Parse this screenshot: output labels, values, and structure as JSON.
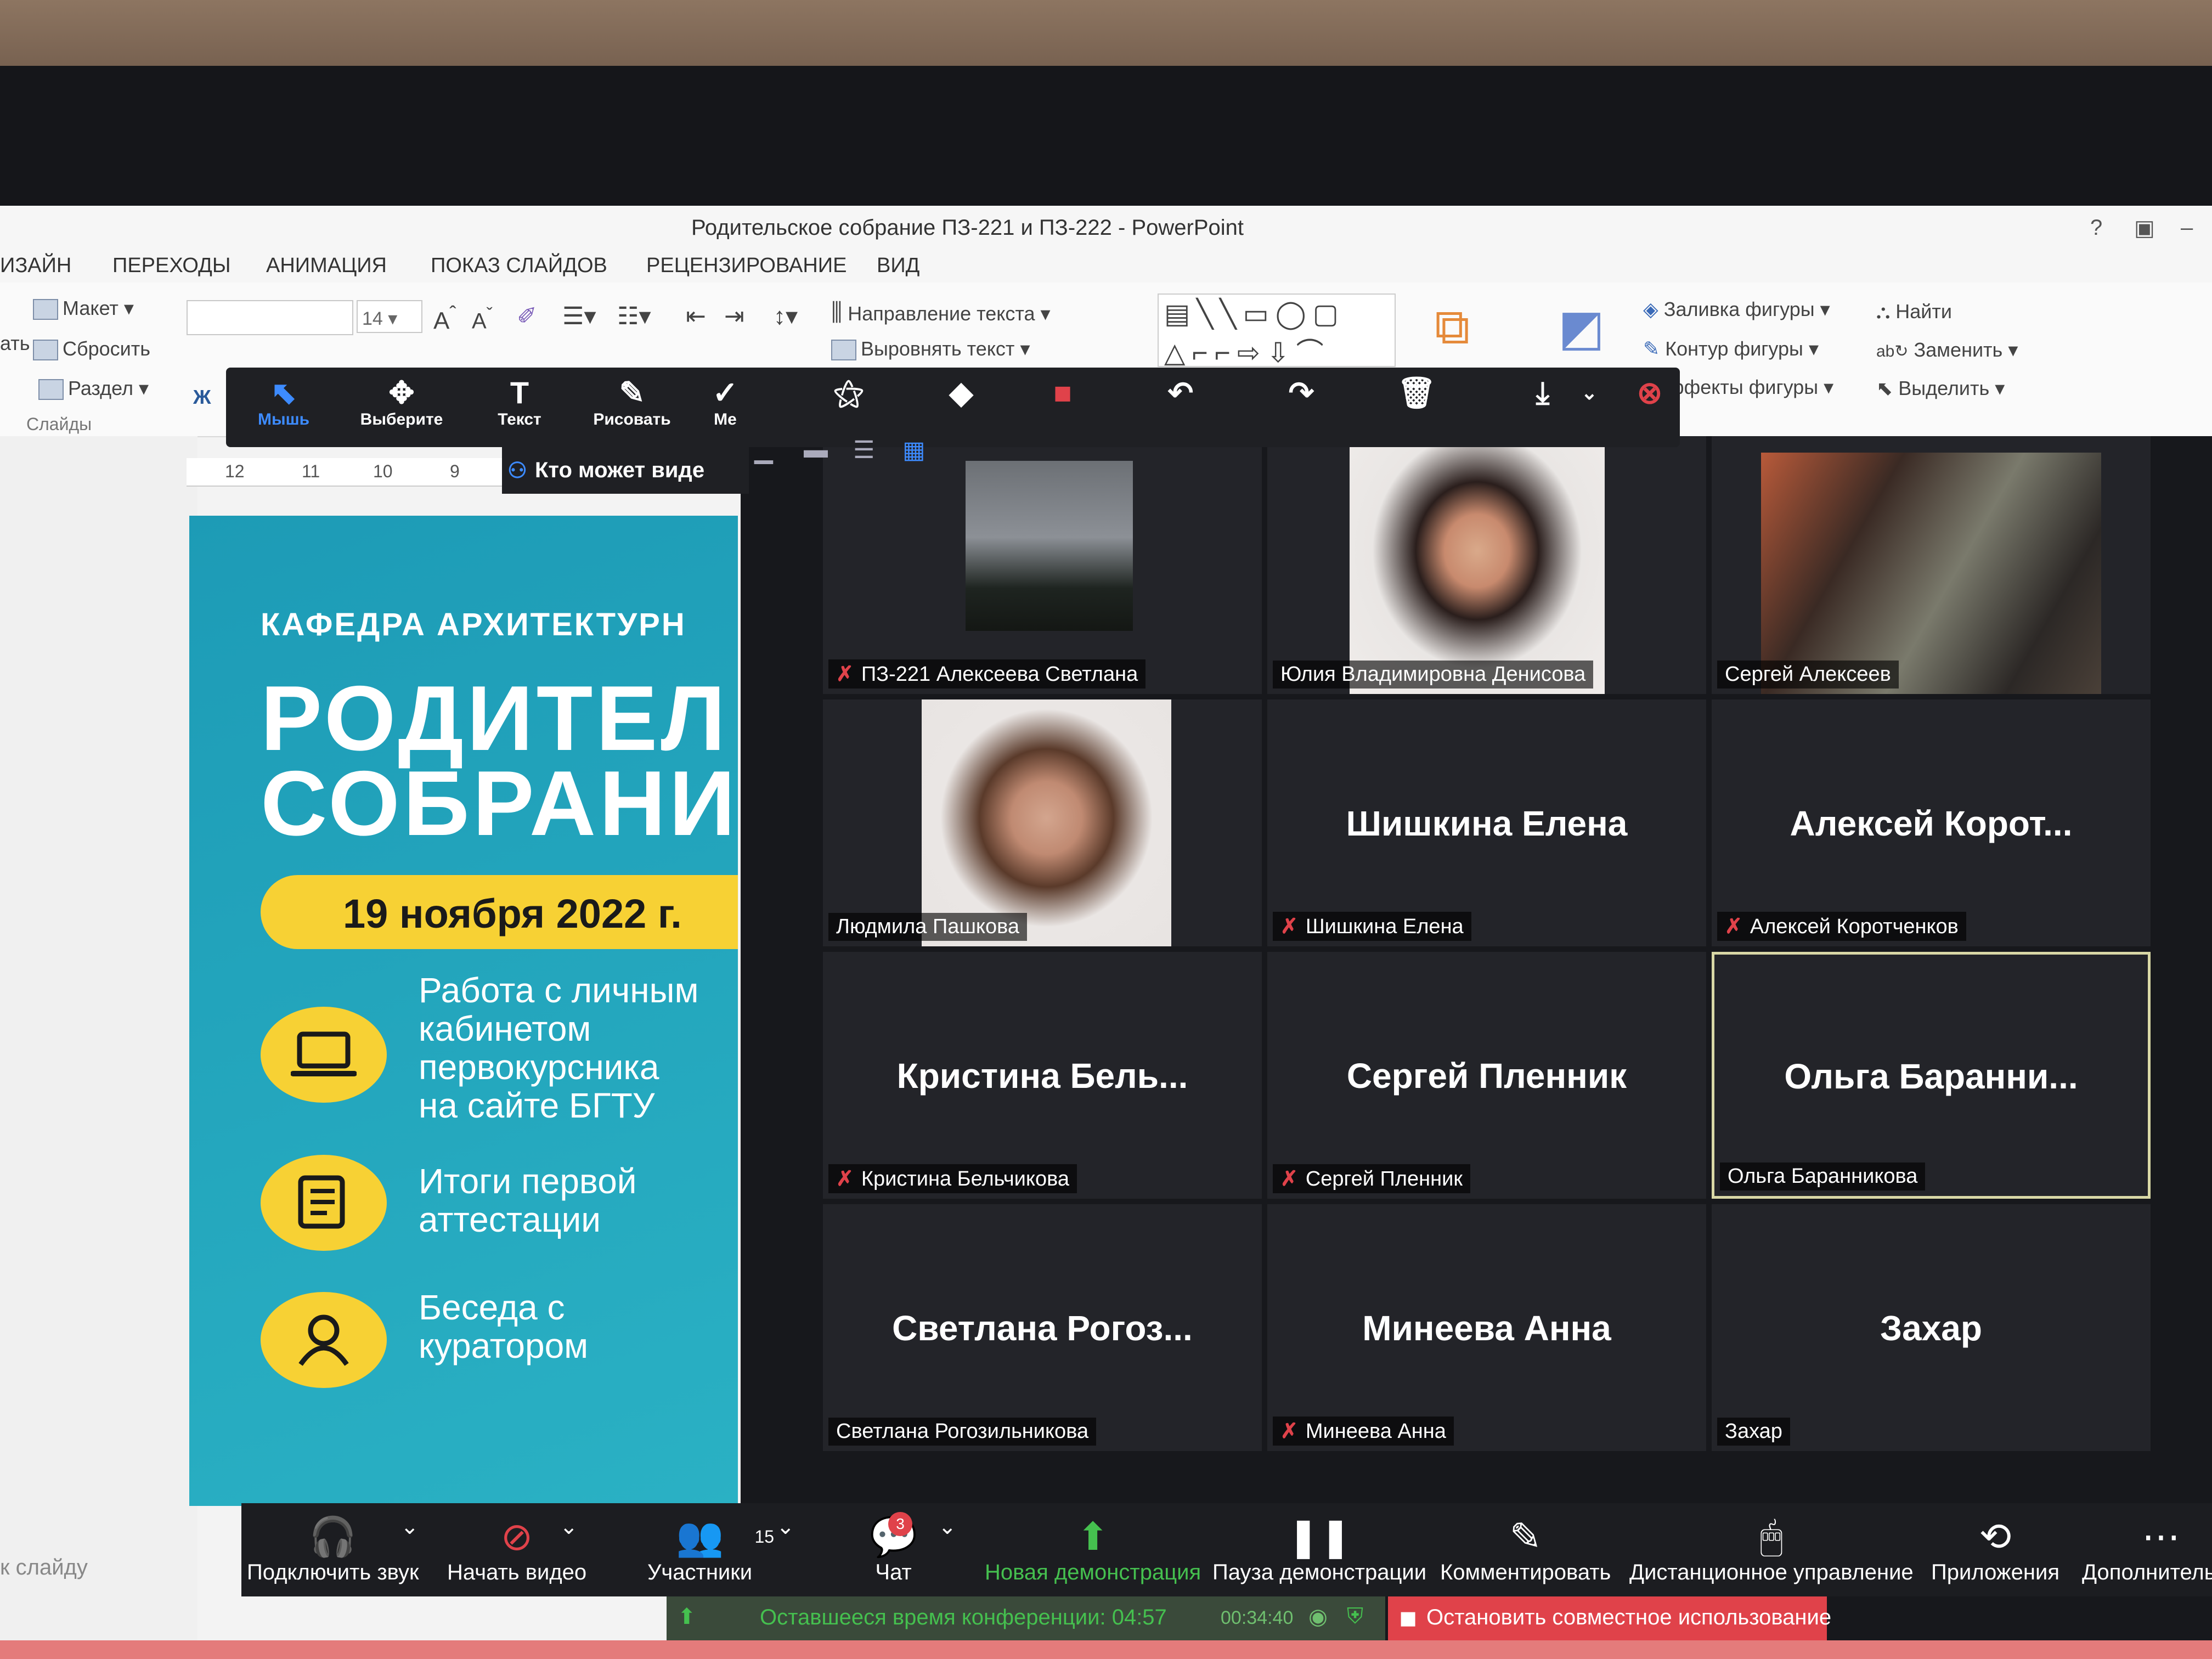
{
  "window_title": "Родительское собрание ПЗ-221 и ПЗ-222 - PowerPoint",
  "window_controls": {
    "help": "?",
    "restore": "▣",
    "minimize": "–"
  },
  "ribbon_tabs": [
    "ИЗАЙН",
    "ПЕРЕХОДЫ",
    "АНИМАЦИЯ",
    "ПОКАЗ СЛАЙДОВ",
    "РЕЦЕНЗИРОВАНИЕ",
    "ВИД"
  ],
  "ribbon": {
    "layout": "Макет",
    "reset": "Сбросить",
    "section": "Раздел",
    "slides_group": "Слайды",
    "partial_left_1": "ать",
    "bold": "Ж",
    "font_size": "14",
    "text_direction": "Направление текста",
    "align_text": "Выровнять текст",
    "shape_fill": "Заливка фигуры",
    "shape_outline": "Контур фигуры",
    "shape_effects": "ффекты фигуры",
    "find": "Найти",
    "replace": "Заменить",
    "select": "Выделить"
  },
  "ruler_ticks": [
    "12",
    "11",
    "10",
    "9"
  ],
  "to_slide": "к слайду",
  "slide": {
    "department": "КАФЕДРА АРХИТЕКТУРН",
    "title_line1": "РОДИТЕЛ",
    "title_line2": "СОБРАНИ",
    "date": "19 ноября 2022 г.",
    "items": [
      {
        "icon": "laptop-icon",
        "lines": [
          "Работа с личным",
          "кабинетом",
          "первокурсника",
          "на сайте БГТУ"
        ]
      },
      {
        "icon": "scroll-icon",
        "lines": [
          "Итоги первой",
          "аттестации"
        ]
      },
      {
        "icon": "person-icon",
        "lines": [
          "Беседа с",
          "куратором"
        ]
      }
    ],
    "colors": {
      "background": "#1d9bb6",
      "accent": "#f7d134"
    }
  },
  "annotation_toolbar": {
    "tools": [
      {
        "label": "Мышь",
        "icon": "pointer-icon"
      },
      {
        "label": "Выберите",
        "icon": "move-icon"
      },
      {
        "label": "Текст",
        "icon": "text-icon"
      },
      {
        "label": "Рисовать",
        "icon": "pen-icon"
      },
      {
        "label": "Ме",
        "icon": "checkmark-icon"
      }
    ],
    "who_can_see": "Кто может виде"
  },
  "participants": [
    {
      "tile_name": "",
      "label": "ПЗ-221 Алексеева Светлана",
      "muted": true
    },
    {
      "tile_name": "",
      "label": "Юлия Владимировна Денисова",
      "muted": false
    },
    {
      "tile_name": "",
      "label": "Сергей Алексеев",
      "muted": false
    },
    {
      "tile_name": "",
      "label": "Людмила Пашкова",
      "muted": false
    },
    {
      "tile_name": "Шишкина Елена",
      "label": "Шишкина Елена",
      "muted": true
    },
    {
      "tile_name": "Алексей Корот...",
      "label": "Алексей Коротченков",
      "muted": true
    },
    {
      "tile_name": "Кристина Бель...",
      "label": "Кристина Бельчикова",
      "muted": true
    },
    {
      "tile_name": "Сергей Пленник",
      "label": "Сергей Пленник",
      "muted": true
    },
    {
      "tile_name": "Ольга Баранни...",
      "label": "Ольга Баранникова",
      "muted": false
    },
    {
      "tile_name": "Светлана Рогоз...",
      "label": "Светлана Рогозильникова",
      "muted": false
    },
    {
      "tile_name": "Минеева Анна",
      "label": "Минеева Анна",
      "muted": true
    },
    {
      "tile_name": "Захар",
      "label": "Захар",
      "muted": false
    }
  ],
  "mute_glyph": "✗",
  "zoom_bar": {
    "join_audio": "Подключить звук",
    "start_video": "Начать видео",
    "participants": "Участники",
    "participants_count": "15",
    "chat": "Чат",
    "chat_badge": "3",
    "new_share": "Новая демонстрация",
    "pause_share": "Пауза демонстрации",
    "annotate": "Комментировать",
    "remote_control": "Дистанционное управление",
    "apps": "Приложения",
    "more": "Дополнительно"
  },
  "meeting_remaining": "Оставшееся время конференции: 04:57",
  "meeting_elapsed": "00:34:40",
  "stop_share": "Остановить совместное использование",
  "colors": {
    "zoom_green": "#45c04f",
    "zoom_red": "#e0424a",
    "active_speaker": "#d9d8a6",
    "zoom_blue": "#3d8bff"
  }
}
